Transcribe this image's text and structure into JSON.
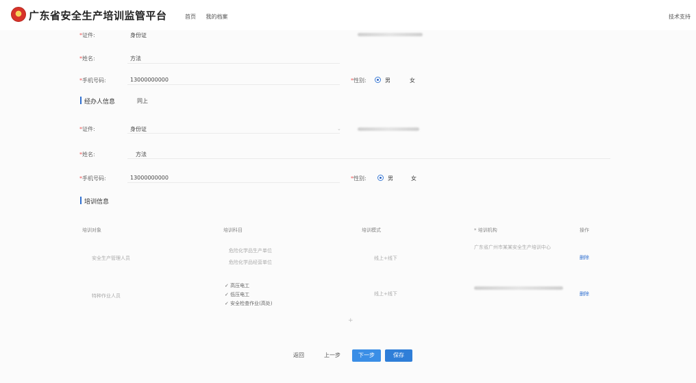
{
  "header": {
    "title": "广东省安全生产培训监管平台",
    "nav": [
      "首页",
      "我的档案"
    ],
    "support": "技术支持"
  },
  "applicant": {
    "id_type_label": "证件:",
    "id_type_value": "身份证",
    "name_label": "姓名:",
    "name_value": "方法",
    "phone_label": "手机号码:",
    "phone_value": "13000000000",
    "gender_label": "性别:",
    "gender_options": [
      "男",
      "女"
    ],
    "gender_selected": "男"
  },
  "agent": {
    "section_title": "经办人信息",
    "same_as": "同上",
    "id_type_label": "证件:",
    "id_type_value": "身份证",
    "name_label": "姓名:",
    "name_value": "方法",
    "phone_label": "手机号码:",
    "phone_value": "13000000000",
    "gender_label": "性别:",
    "gender_options": [
      "男",
      "女"
    ],
    "gender_selected": "男"
  },
  "training": {
    "section_title": "培训信息",
    "columns": [
      "培训对象",
      "培训科目",
      "培训模式",
      "* 培训机构",
      "操作"
    ],
    "rows": [
      {
        "target": "安全生产管理人员",
        "subjects": [
          "危险化学品生产单位",
          "危险化学品经营单位"
        ],
        "mode": "线上+线下",
        "institution": "广东省广州市某某安全生产培训中心",
        "action": "删除"
      },
      {
        "target": "特种作业人员",
        "subjects": [
          "高压电工",
          "低压电工",
          "安全检查作业(高处)"
        ],
        "mode": "线上+线下",
        "institution": "",
        "action": "删除"
      }
    ]
  },
  "actions": {
    "back": "返回",
    "prev": "上一步",
    "next": "下一步",
    "save": "保存"
  }
}
